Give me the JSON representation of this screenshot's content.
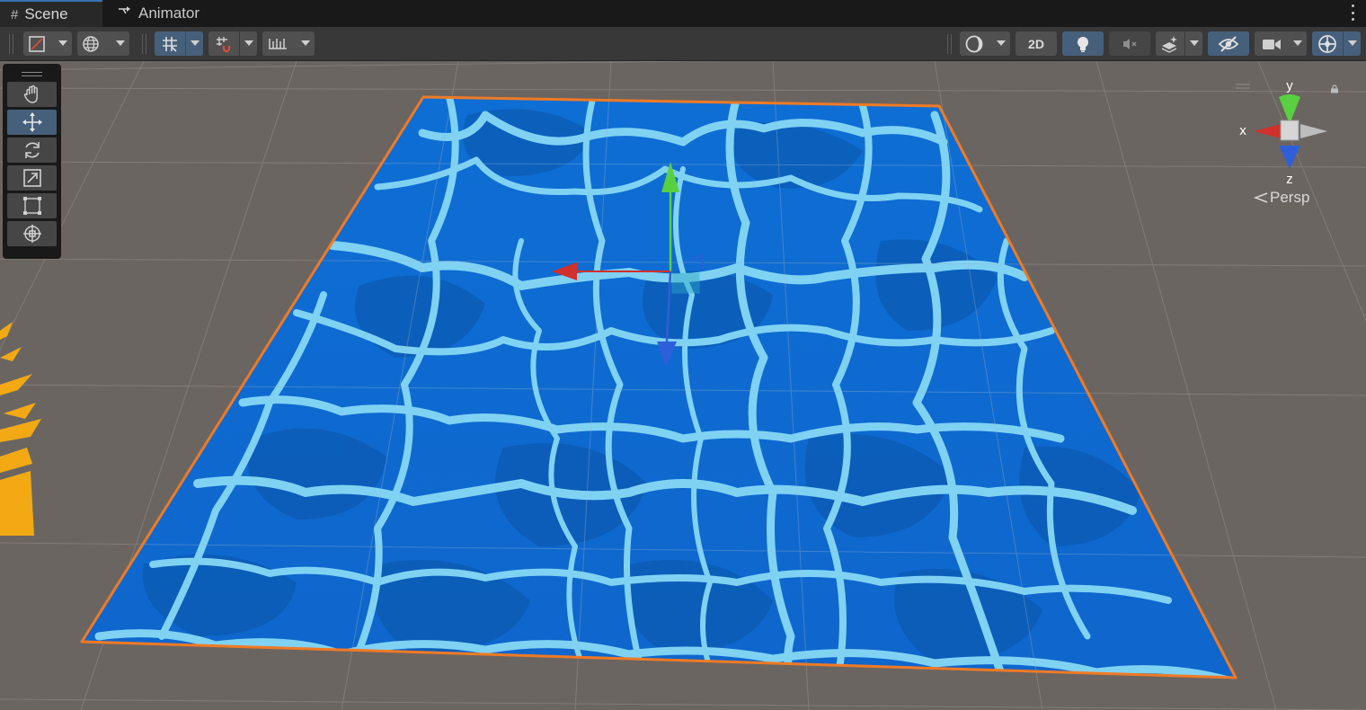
{
  "tabs": [
    {
      "label": "Scene",
      "icon": "hash-icon",
      "active": true
    },
    {
      "label": "Animator",
      "icon": "animator-icon",
      "active": false
    }
  ],
  "toolbar": {
    "toggle_2d_label": "2D"
  },
  "tools": [
    "hand-tool",
    "move-tool",
    "rotate-tool",
    "scale-tool",
    "rect-tool",
    "transform-tool"
  ],
  "gizmo": {
    "y_label": "y",
    "x_label": "x",
    "z_label": "z",
    "projection_label": "Persp"
  },
  "colors": {
    "water_deep": "#0f5fb4",
    "water_mid": "#1a7ee0",
    "caustic": "#7fd0f2",
    "selection_outline": "#f07a24",
    "axis_x": "#d2302a",
    "axis_y": "#58d040",
    "axis_z": "#2f5fd8",
    "active_button": "#46607c"
  }
}
